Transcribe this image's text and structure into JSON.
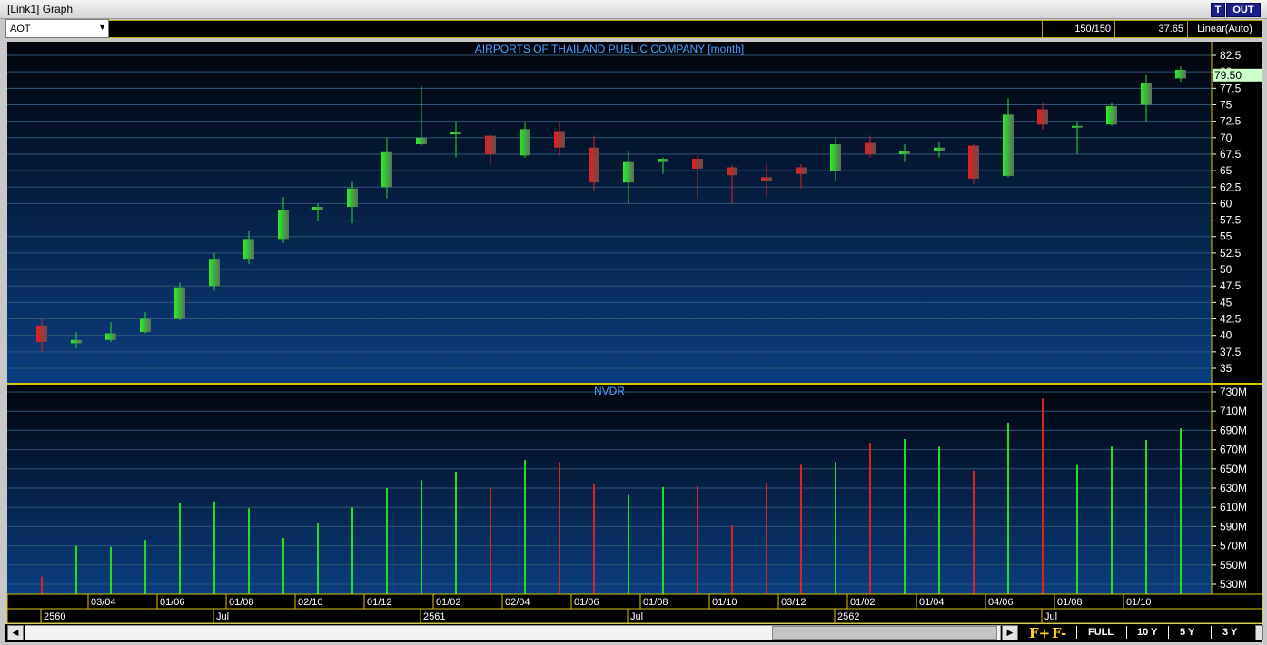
{
  "window": {
    "title": "[Link1] Graph",
    "btn_t": "T",
    "btn_out": "OUT"
  },
  "toolbar": {
    "symbol": "AOT",
    "dropdown_icon": "triangle-down-icon",
    "count": "150/150",
    "value": "37.65",
    "scale": "Linear(Auto)"
  },
  "colors": {
    "up": "#22dd22",
    "down": "#dd2222",
    "accent_border": "#d8c800",
    "text": "#4aa0ff"
  },
  "chart_data": [
    {
      "type": "candlestick",
      "title": "AIRPORTS OF THAILAND PUBLIC COMPANY [month]",
      "last_price_label": "79.50",
      "last_price": 79.5,
      "ylim": [
        32.5,
        84
      ],
      "yticks": [
        "82.5",
        "80",
        "77.5",
        "75",
        "72.5",
        "70",
        "67.5",
        "65",
        "62.5",
        "60",
        "57.5",
        "55",
        "52.5",
        "50",
        "47.5",
        "45",
        "42.5",
        "40",
        "37.5",
        "35"
      ],
      "grid": true,
      "candles": [
        {
          "open": 41.5,
          "close": 39,
          "high": 42.5,
          "low": 37.5
        },
        {
          "open": 38.8,
          "close": 39.3,
          "high": 40.5,
          "low": 38
        },
        {
          "open": 39.3,
          "close": 40.3,
          "high": 42,
          "low": 39
        },
        {
          "open": 40.5,
          "close": 42.5,
          "high": 43.5,
          "low": 40.3
        },
        {
          "open": 42.5,
          "close": 47.3,
          "high": 48,
          "low": 42.3
        },
        {
          "open": 47.5,
          "close": 51.5,
          "high": 52.5,
          "low": 46.8
        },
        {
          "open": 51.5,
          "close": 54.5,
          "high": 55.8,
          "low": 50.8
        },
        {
          "open": 54.5,
          "close": 59,
          "high": 61,
          "low": 54
        },
        {
          "open": 59,
          "close": 59.5,
          "high": 60,
          "low": 57.3
        },
        {
          "open": 59.5,
          "close": 62.3,
          "high": 63.5,
          "low": 57
        },
        {
          "open": 62.5,
          "close": 67.8,
          "high": 70,
          "low": 60.8
        },
        {
          "open": 69,
          "close": 70,
          "high": 77.8,
          "low": 68.8
        },
        {
          "open": 70.5,
          "close": 70.8,
          "high": 72.5,
          "low": 67
        },
        {
          "open": 70.3,
          "close": 67.5,
          "high": 70.5,
          "low": 65.8
        },
        {
          "open": 67.3,
          "close": 71.3,
          "high": 72.3,
          "low": 67
        },
        {
          "open": 71,
          "close": 68.5,
          "high": 72.3,
          "low": 67.2
        },
        {
          "open": 68.5,
          "close": 63.2,
          "high": 70.3,
          "low": 62
        },
        {
          "open": 63.2,
          "close": 66.3,
          "high": 68,
          "low": 60
        },
        {
          "open": 66.3,
          "close": 66.8,
          "high": 67,
          "low": 64.5
        },
        {
          "open": 66.8,
          "close": 65.3,
          "high": 67.3,
          "low": 60.8
        },
        {
          "open": 65.5,
          "close": 64.3,
          "high": 65.8,
          "low": 60
        },
        {
          "open": 64,
          "close": 63.5,
          "high": 66,
          "low": 61
        },
        {
          "open": 65.5,
          "close": 64.5,
          "high": 66,
          "low": 62.3
        },
        {
          "open": 65,
          "close": 69,
          "high": 70,
          "low": 63.5
        },
        {
          "open": 69.2,
          "close": 67.5,
          "high": 70.3,
          "low": 67
        },
        {
          "open": 67.5,
          "close": 68,
          "high": 69,
          "low": 66.3
        },
        {
          "open": 68,
          "close": 68.5,
          "high": 69.3,
          "low": 67
        },
        {
          "open": 68.8,
          "close": 63.8,
          "high": 69,
          "low": 63
        },
        {
          "open": 64.2,
          "close": 73.5,
          "high": 76,
          "low": 64
        },
        {
          "open": 74.3,
          "close": 72,
          "high": 75.3,
          "low": 71.3
        },
        {
          "open": 71.8,
          "close": 71.8,
          "high": 72.5,
          "low": 67.5
        },
        {
          "open": 72,
          "close": 74.8,
          "high": 75.3,
          "low": 71.8
        },
        {
          "open": 75,
          "close": 78.3,
          "high": 79.5,
          "low": 72.5
        },
        {
          "open": 79,
          "close": 80.3,
          "high": 80.8,
          "low": 78.5
        }
      ]
    },
    {
      "type": "bar",
      "title": "NVDR",
      "ylim": [
        520,
        735
      ],
      "yticks": [
        "730M",
        "710M",
        "690M",
        "670M",
        "650M",
        "630M",
        "610M",
        "590M",
        "570M",
        "550M",
        "530M"
      ],
      "values": [
        538,
        570,
        569,
        576,
        615,
        616,
        609,
        578,
        594,
        610,
        630,
        638,
        647,
        631,
        659,
        657,
        634,
        623,
        631,
        632,
        591,
        636,
        654,
        657,
        677,
        681,
        673,
        648,
        698,
        723,
        654,
        673,
        680,
        692
      ]
    }
  ],
  "xaxis": {
    "month_labels": [
      "03/04",
      "01/06",
      "01/08",
      "02/10",
      "01/12",
      "01/02",
      "02/04",
      "01/06",
      "01/08",
      "01/10",
      "03/12",
      "01/02",
      "01/04",
      "04/06",
      "01/08",
      "01/10"
    ],
    "year_labels": [
      "2560",
      "Jul",
      "2561",
      "Jul",
      "2562",
      "Jul"
    ]
  },
  "bottom": {
    "f_plus": "F+",
    "f_minus": "F-",
    "ranges": [
      "FULL",
      "10 Y",
      "5 Y",
      "3 Y"
    ],
    "scroll_left_icon": "triangle-left-icon",
    "scroll_right_icon": "triangle-right-icon"
  }
}
